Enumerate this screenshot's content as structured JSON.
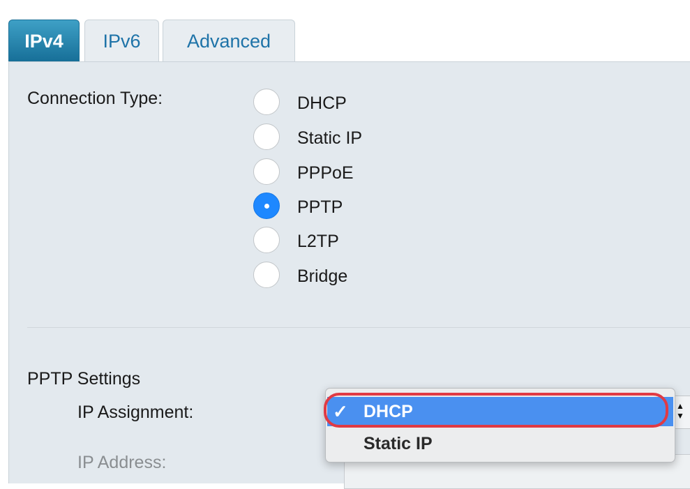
{
  "tabs": [
    {
      "label": "IPv4",
      "active": true
    },
    {
      "label": "IPv6",
      "active": false
    },
    {
      "label": "Advanced",
      "active": false
    }
  ],
  "connection_type": {
    "label": "Connection Type:",
    "options": [
      "DHCP",
      "Static IP",
      "PPPoE",
      "PPTP",
      "L2TP",
      "Bridge"
    ],
    "selected": "PPTP"
  },
  "pptp_settings": {
    "heading": "PPTP Settings",
    "ip_assignment_label": "IP Assignment:",
    "ip_address_label": "IP Address:"
  },
  "ip_assignment_dropdown": {
    "options": [
      "DHCP",
      "Static IP"
    ],
    "selected": "DHCP",
    "check_glyph": "✓"
  },
  "colors": {
    "active_tab": "#1b7fa8",
    "tab_text": "#1e73a8",
    "panel_bg": "#e3e9ee",
    "radio_checked": "#1e88ff",
    "dropdown_selected": "#4a90f0",
    "highlight": "#e03a44"
  }
}
